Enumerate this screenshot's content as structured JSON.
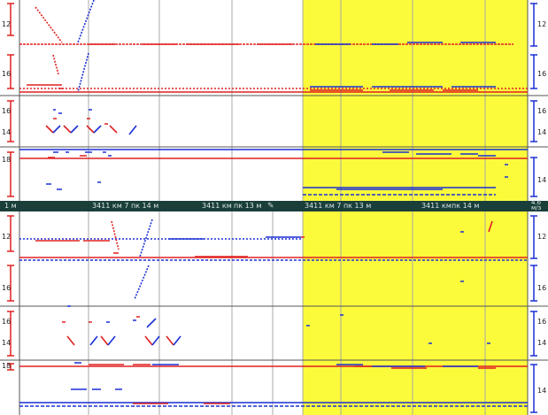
{
  "highlight_color": "#fbfb3c",
  "rail_colors": {
    "left_rail": "#e02020",
    "right_rail": "#1a2fd6"
  },
  "top_block": {
    "channel_a_ticks": [
      "12",
      "16"
    ],
    "channel_b_ticks": [
      "16",
      "14"
    ],
    "channel_c_ticks": [
      "18",
      "14"
    ]
  },
  "bottom_block": {
    "channel_a_ticks": [
      "12",
      "16"
    ],
    "channel_b_ticks": [
      "16",
      "14"
    ],
    "channel_c_ticks": [
      "18",
      "14"
    ]
  },
  "position_strip": {
    "scale_left": "1 м",
    "marks": [
      "3411 км 7 пк 14 м",
      "3411 км",
      "пк 13 м",
      "3411 км 7 пк 13 м",
      "3411 км",
      "пк 14 м"
    ],
    "speed_value": "4.6",
    "speed_unit": "м/з"
  }
}
